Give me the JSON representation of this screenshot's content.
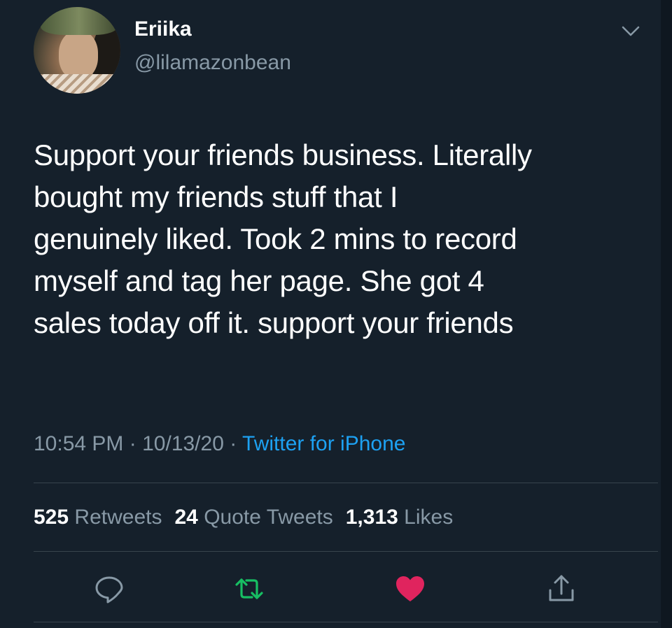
{
  "user": {
    "display_name": "Eriika",
    "handle": "@lilamazonbean",
    "avatar_icon": "profile-photo"
  },
  "tweet": {
    "text": "Support your friends business. Literally\nbought my friends stuff that I\ngenuinely liked. Took 2 mins to record\nmyself and tag her page. She got 4\nsales today off it. support your friends",
    "time": "10:54 PM",
    "separator": "·",
    "date": "10/13/20",
    "source": "Twitter for iPhone"
  },
  "stats": {
    "retweets_count": "525",
    "retweets_label": "Retweets",
    "quotes_count": "24",
    "quotes_label": "Quote Tweets",
    "likes_count": "1,313",
    "likes_label": "Likes"
  },
  "actions": {
    "reply_icon": "reply-icon",
    "retweet_icon": "retweet-icon",
    "like_icon": "heart-icon",
    "share_icon": "share-icon"
  },
  "colors": {
    "background": "#15202b",
    "secondary_text": "#8899a6",
    "link": "#1da1f2",
    "retweet_green": "#17bf63",
    "like_red": "#e0245e"
  }
}
